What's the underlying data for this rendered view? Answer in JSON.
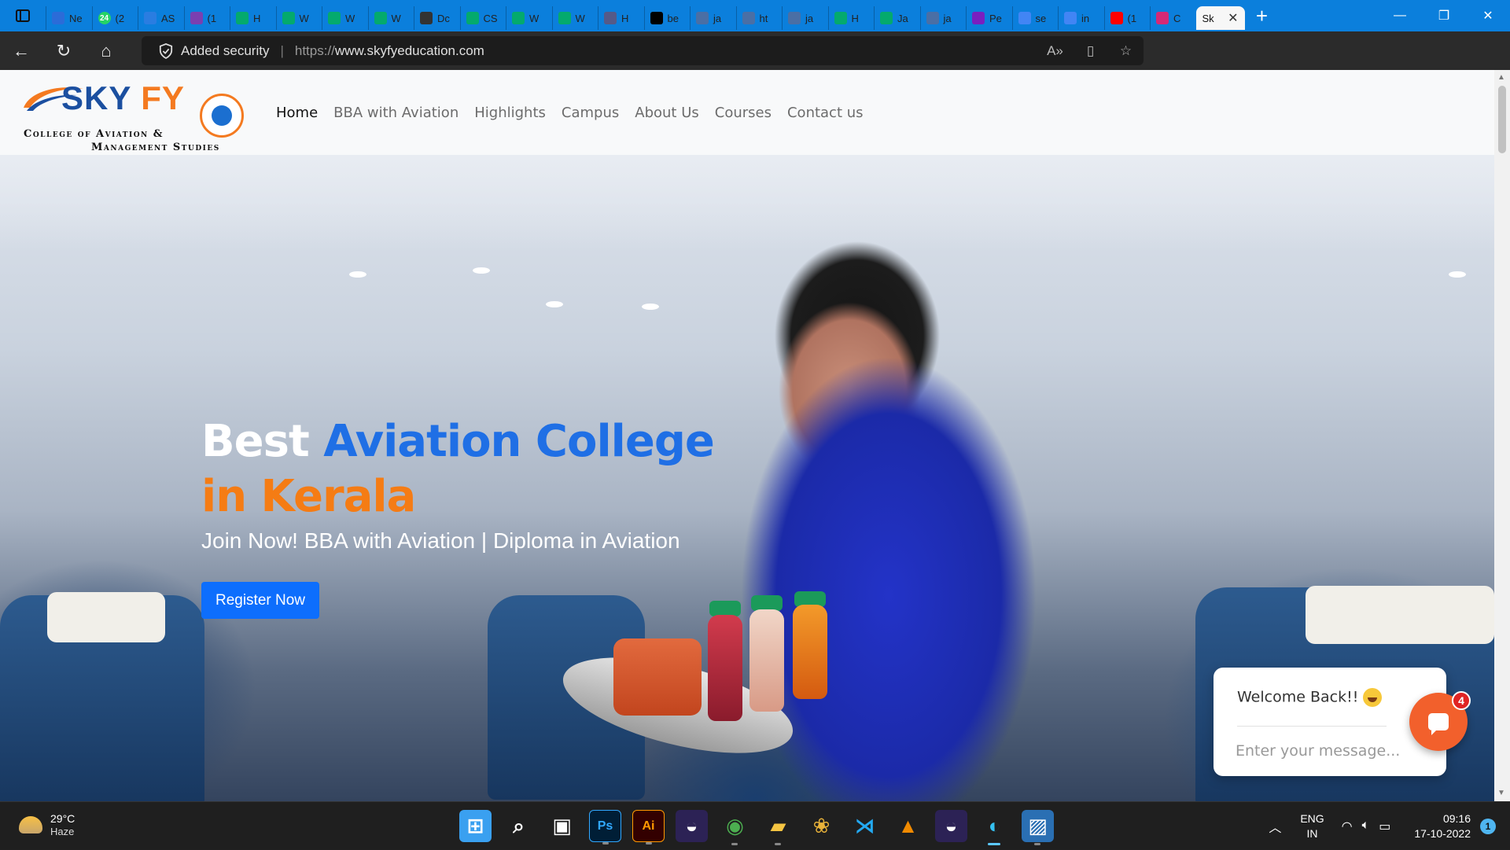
{
  "browser": {
    "tabs": [
      {
        "label": "Ne",
        "icon": "outlook-icon",
        "color": "#2b6cd8"
      },
      {
        "label": "(2",
        "icon": "whatsapp-icon",
        "color": "#25d366",
        "badge": "24"
      },
      {
        "label": "AS",
        "icon": "app-icon",
        "color": "#2a7de1"
      },
      {
        "label": "(1",
        "icon": "video-icon",
        "color": "#7a3fb0"
      },
      {
        "label": "H",
        "icon": "w3-icon",
        "color": "#04aa6d"
      },
      {
        "label": "W",
        "icon": "w3-icon",
        "color": "#04aa6d"
      },
      {
        "label": "W",
        "icon": "w3-icon",
        "color": "#04aa6d"
      },
      {
        "label": "W",
        "icon": "w3-icon",
        "color": "#04aa6d"
      },
      {
        "label": "Dc",
        "icon": "document-icon",
        "color": "#333333"
      },
      {
        "label": "CS",
        "icon": "w3-icon",
        "color": "#04aa6d"
      },
      {
        "label": "W",
        "icon": "w3-icon",
        "color": "#04aa6d"
      },
      {
        "label": "W",
        "icon": "w3-icon",
        "color": "#04aa6d"
      },
      {
        "label": "H",
        "icon": "html-icon",
        "color": "#555a88"
      },
      {
        "label": "be",
        "icon": "medium-icon",
        "color": "#000000"
      },
      {
        "label": "ja",
        "icon": "pen-icon",
        "color": "#4a6fa5"
      },
      {
        "label": "ht",
        "icon": "pen-icon",
        "color": "#4a6fa5"
      },
      {
        "label": "ja",
        "icon": "pen-icon",
        "color": "#4a6fa5"
      },
      {
        "label": "H",
        "icon": "w3-icon",
        "color": "#04aa6d"
      },
      {
        "label": "Ja",
        "icon": "w3-icon",
        "color": "#04aa6d"
      },
      {
        "label": "ja",
        "icon": "pen-icon",
        "color": "#4a6fa5"
      },
      {
        "label": "Pe",
        "icon": "bootstrap-icon",
        "color": "#7a1fbf"
      },
      {
        "label": "se",
        "icon": "google-icon",
        "color": "#4285f4"
      },
      {
        "label": "in",
        "icon": "google-icon",
        "color": "#4285f4"
      },
      {
        "label": "(1",
        "icon": "youtube-icon",
        "color": "#ff0000"
      },
      {
        "label": "C",
        "icon": "instagram-icon",
        "color": "#d62976"
      }
    ],
    "active_tab": {
      "label": "Sk"
    },
    "address": {
      "security_label": "Added security",
      "protocol": "https://",
      "domain": "www.skyfyeducation.com"
    }
  },
  "site": {
    "logo": {
      "name_part1": "SKY",
      "name_part2": "FY",
      "line1": "College of Aviation &",
      "line2": "Management Studies"
    },
    "nav": [
      {
        "label": "Home",
        "active": true
      },
      {
        "label": "BBA with Aviation",
        "active": false
      },
      {
        "label": "Highlights",
        "active": false
      },
      {
        "label": "Campus",
        "active": false
      },
      {
        "label": "About Us",
        "active": false
      },
      {
        "label": "Courses",
        "active": false
      },
      {
        "label": "Contact us",
        "active": false
      }
    ],
    "hero": {
      "title_white": "Best",
      "title_blue": "Aviation College",
      "title_orange": "in Kerala",
      "subtitle": "Join Now! BBA with Aviation | Diploma in Aviation",
      "cta": "Register Now"
    },
    "chat": {
      "welcome": "Welcome Back!!",
      "placeholder": "Enter your message...",
      "badge_count": "4"
    }
  },
  "taskbar": {
    "weather": {
      "temp": "29°C",
      "condition": "Haze"
    },
    "apps": [
      {
        "name": "windows-start-icon",
        "label": ""
      },
      {
        "name": "search-icon",
        "label": ""
      },
      {
        "name": "task-view-icon",
        "label": ""
      },
      {
        "name": "photoshop-icon",
        "label": "Ps"
      },
      {
        "name": "illustrator-icon",
        "label": "Ai"
      },
      {
        "name": "eclipse-icon",
        "label": ""
      },
      {
        "name": "chrome-icon",
        "label": ""
      },
      {
        "name": "file-explorer-icon",
        "label": ""
      },
      {
        "name": "fruit-app-icon",
        "label": ""
      },
      {
        "name": "vscode-icon",
        "label": ""
      },
      {
        "name": "vlc-icon",
        "label": ""
      },
      {
        "name": "eclipse-icon-2",
        "label": ""
      },
      {
        "name": "edge-icon",
        "label": ""
      },
      {
        "name": "photos-icon",
        "label": ""
      }
    ],
    "language": {
      "line1": "ENG",
      "line2": "IN"
    },
    "clock": {
      "time": "09:16",
      "date": "17-10-2022"
    },
    "notification_count": "1"
  },
  "colors": {
    "accent_blue": "#0d6efd",
    "title_blue": "#1f6fe5",
    "title_orange": "#f57c14",
    "chat_orange": "#f2602c"
  }
}
